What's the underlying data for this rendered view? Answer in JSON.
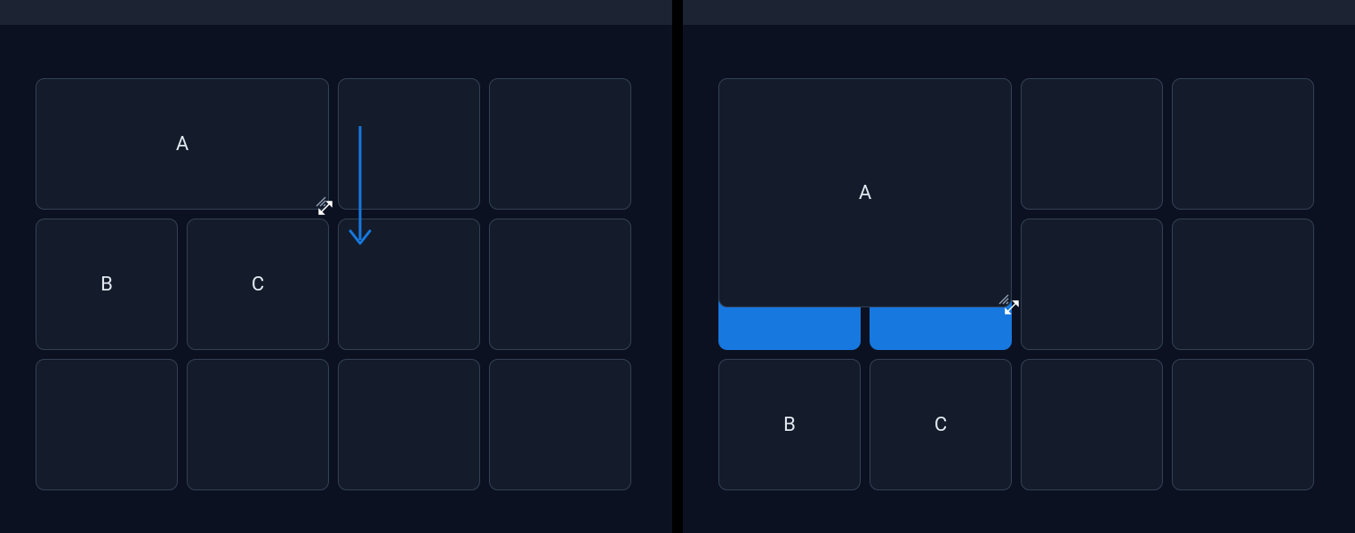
{
  "colors": {
    "accent": "#1778e0",
    "panel_bg": "#141c2b",
    "panel_border": "#334155",
    "page_bg": "#0b1120",
    "topbar_bg": "#1c2433"
  },
  "left": {
    "panelA": {
      "label": "A"
    },
    "cellB": {
      "label": "B"
    },
    "cellC": {
      "label": "C"
    }
  },
  "right": {
    "panelA": {
      "label": "A"
    },
    "cellB": {
      "label": "B"
    },
    "cellC": {
      "label": "C"
    }
  }
}
